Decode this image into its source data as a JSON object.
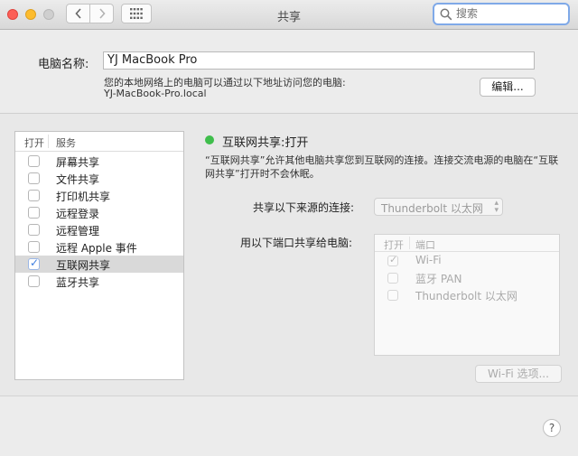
{
  "window": {
    "title": "共享"
  },
  "search": {
    "placeholder": "搜索"
  },
  "computer_name": {
    "label": "电脑名称:",
    "value": "YJ MacBook Pro",
    "address_desc": "您的本地网络上的电脑可以通过以下地址访问您的电脑:",
    "hostname": "YJ-MacBook-Pro.local",
    "edit_label": "编辑..."
  },
  "services": {
    "header_on": "打开",
    "header_service": "服务",
    "items": [
      {
        "label": "屏幕共享",
        "checked": false
      },
      {
        "label": "文件共享",
        "checked": false
      },
      {
        "label": "打印机共享",
        "checked": false
      },
      {
        "label": "远程登录",
        "checked": false
      },
      {
        "label": "远程管理",
        "checked": false
      },
      {
        "label": "远程 Apple 事件",
        "checked": false
      },
      {
        "label": "互联网共享",
        "checked": true
      },
      {
        "label": "蓝牙共享",
        "checked": false
      }
    ]
  },
  "detail": {
    "status": "互联网共享:打开",
    "status_color": "#3fbe4c",
    "desc_line1": "“互联网共享”允许其他电脑共享您到互联网的连接。连接交流电源的电脑在“互联",
    "desc_line2": "网共享”打开时不会休眠。",
    "source_label": "共享以下来源的连接:",
    "source_value": "Thunderbolt 以太网",
    "ports_label": "用以下端口共享给电脑:",
    "ports_header_on": "打开",
    "ports_header_port": "端口",
    "ports": [
      {
        "label": "Wi-Fi",
        "checked": true
      },
      {
        "label": "蓝牙 PAN",
        "checked": false
      },
      {
        "label": "Thunderbolt 以太网",
        "checked": false
      }
    ],
    "wifi_options_label": "Wi-Fi 选项..."
  },
  "help": {
    "label": "?"
  }
}
